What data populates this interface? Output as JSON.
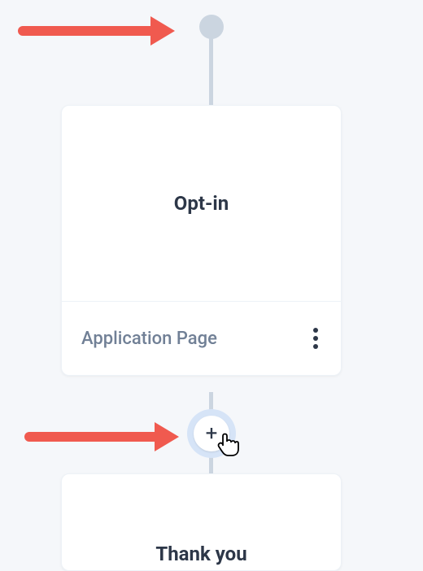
{
  "flow": {
    "start_node": true,
    "card1": {
      "title": "Opt-in",
      "footer_label": "Application Page"
    },
    "card2": {
      "title": "Thank you"
    },
    "add_button": {
      "symbol": "+"
    }
  },
  "annotations": {
    "arrow_color": "#f05a4f"
  }
}
